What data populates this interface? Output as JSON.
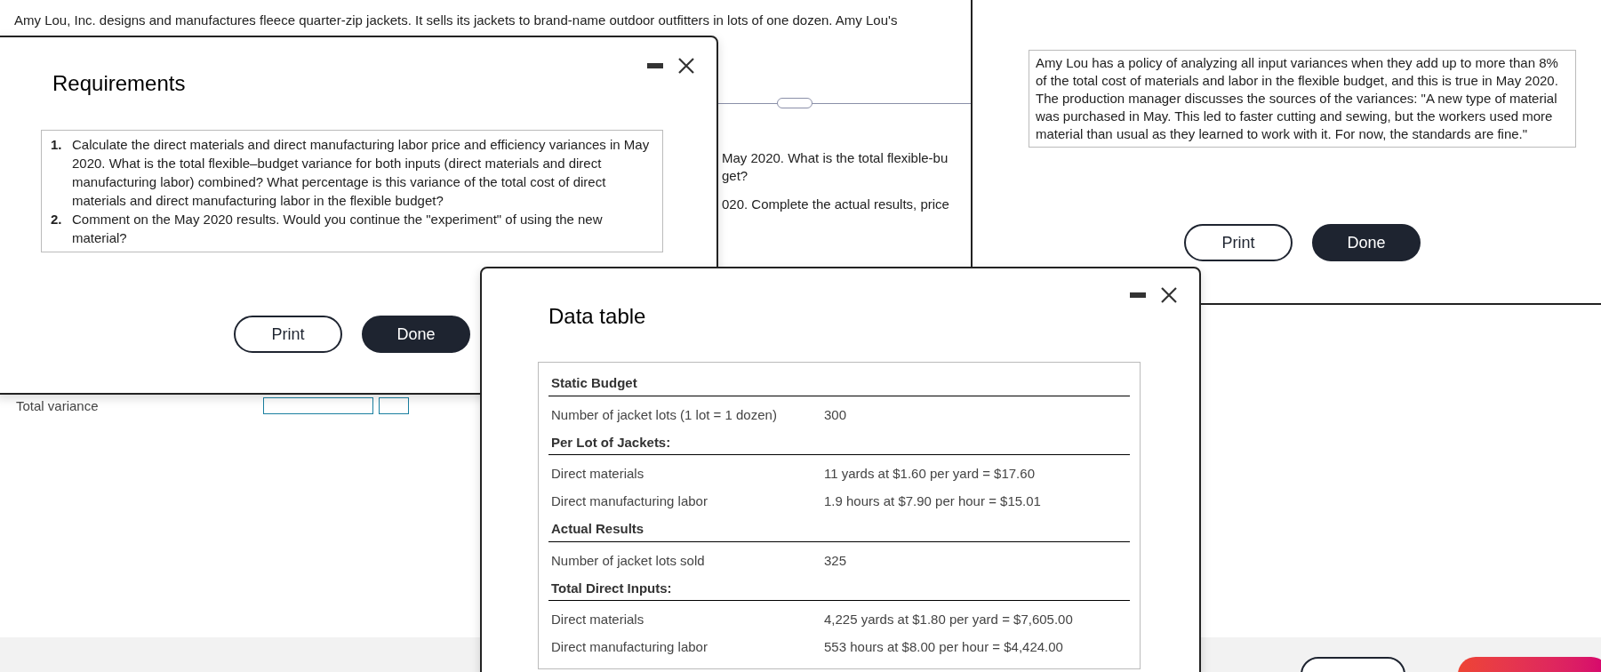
{
  "background": {
    "question": "Amy Lou, Inc. designs and manufactures fleece quarter-zip jackets. It sells its jackets to brand-name outdoor outfitters in lots of one dozen. Amy Lou's",
    "fragments": [
      "May 2020. What is the total flexible-bu",
      "get?",
      "020. Complete the actual results, price"
    ],
    "total_variance_label": "Total variance"
  },
  "requirements_window": {
    "title": "Requirements",
    "items": [
      {
        "number": "1.",
        "text": "Calculate the direct materials and direct manufacturing labor price and efficiency variances in May 2020. What is the total flexible–budget variance for both inputs (direct materials and direct manufacturing labor) combined? What percentage is this variance of the total cost of direct materials and direct manufacturing labor in the flexible budget?"
      },
      {
        "number": "2.",
        "text": "Comment on the May 2020 results. Would you continue the \"experiment\" of using the new material?"
      }
    ],
    "buttons": [
      {
        "label": "Print",
        "kind": "secondary"
      },
      {
        "label": "Done",
        "kind": "primary"
      }
    ]
  },
  "more_info_window": {
    "text": "Amy Lou has a policy of analyzing all input variances when they add up to more than 8% of the total cost of materials and labor in the flexible budget, and this is true in May 2020. The production manager discusses the sources of the variances: \"A new type of material was purchased in May. This led to faster cutting and sewing, but the workers used more material than usual as they learned to work with it. For now, the standards are fine.\"",
    "buttons": [
      {
        "label": "Print",
        "kind": "secondary"
      },
      {
        "label": "Done",
        "kind": "primary"
      }
    ]
  },
  "data_table_window": {
    "title": "Data table",
    "sections": [
      {
        "heading": "Static Budget",
        "rows": [
          {
            "label": "Number of jacket lots (1 lot = 1 dozen)",
            "value": "300"
          }
        ]
      },
      {
        "heading": "Per Lot of Jackets:",
        "rows": [
          {
            "label": "Direct materials",
            "value": "11 yards at $1.60 per yard = $17.60"
          },
          {
            "label": "Direct manufacturing labor",
            "value": "1.9 hours at $7.90 per hour = $15.01"
          }
        ]
      },
      {
        "heading": "Actual Results",
        "rows": [
          {
            "label": "Number of jacket lots sold",
            "value": "325"
          }
        ]
      },
      {
        "heading": "Total Direct Inputs:",
        "rows": [
          {
            "label": "Direct materials",
            "value": "4,225 yards at $1.80 per yard = $7,605.00"
          },
          {
            "label": "Direct manufacturing labor",
            "value": "553 hours at $8.00 per hour = $4,424.00"
          }
        ]
      }
    ]
  }
}
